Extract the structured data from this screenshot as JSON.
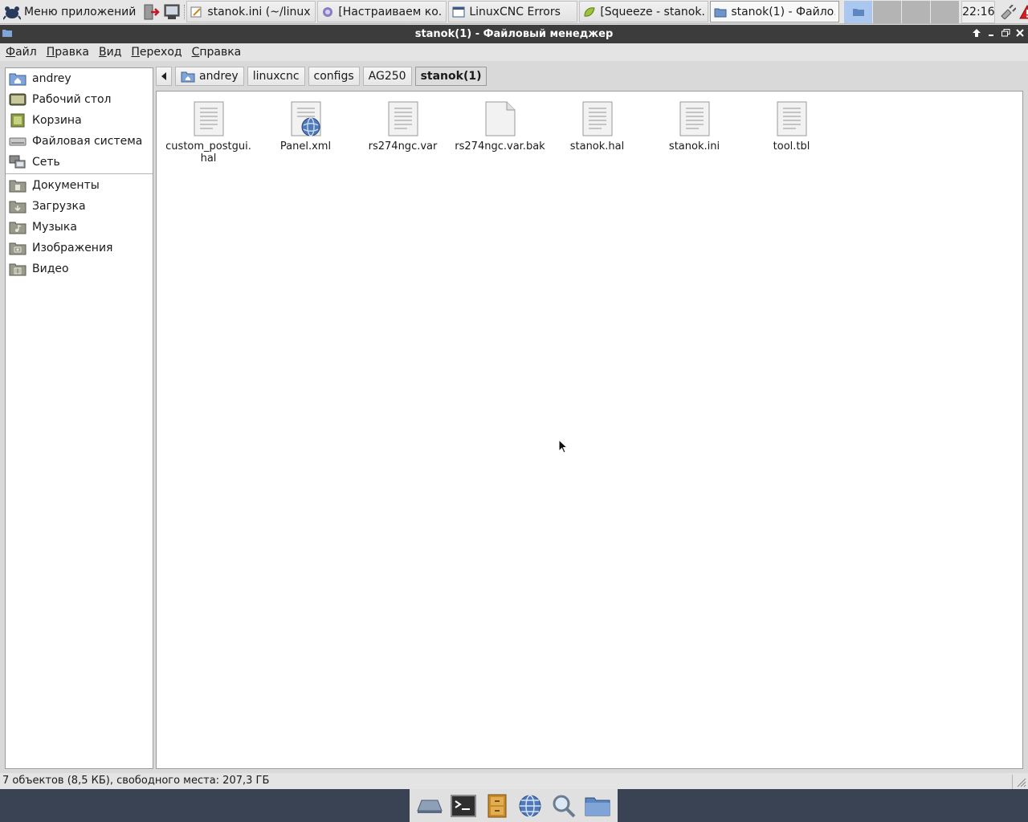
{
  "top_panel": {
    "app_menu_label": "Меню приложений",
    "tasks": [
      {
        "label": "stanok.ini (~/linux...",
        "icon": "edit-icon"
      },
      {
        "label": "[Настраиваем ко...",
        "icon": "browser-icon"
      },
      {
        "label": "LinuxCNC Errors",
        "icon": "window-icon"
      },
      {
        "label": "[Squeeze - stanok...",
        "icon": "leaf-icon"
      },
      {
        "label": "stanok(1) - Файло...",
        "icon": "folder-icon"
      }
    ],
    "clock": "22:16"
  },
  "window": {
    "title": "stanok(1) - Файловый менеджер"
  },
  "menubar": [
    {
      "mnemonic": "Ф",
      "rest": "айл"
    },
    {
      "mnemonic": "П",
      "rest": "равка"
    },
    {
      "mnemonic": "В",
      "rest": "ид"
    },
    {
      "mnemonic": "П",
      "rest": "ереход"
    },
    {
      "mnemonic": "С",
      "rest": "правка"
    }
  ],
  "sidebar": {
    "places": [
      {
        "label": "andrey",
        "icon": "home-folder-icon"
      },
      {
        "label": "Рабочий стол",
        "icon": "desktop-icon"
      },
      {
        "label": "Корзина",
        "icon": "trash-icon"
      },
      {
        "label": "Файловая система",
        "icon": "drive-icon"
      },
      {
        "label": "Сеть",
        "icon": "network-icon"
      }
    ],
    "bookmarks": [
      {
        "label": "Документы",
        "icon": "documents-folder-icon"
      },
      {
        "label": "Загрузка",
        "icon": "downloads-folder-icon"
      },
      {
        "label": "Музыка",
        "icon": "music-folder-icon"
      },
      {
        "label": "Изображения",
        "icon": "pictures-folder-icon"
      },
      {
        "label": "Видео",
        "icon": "video-folder-icon"
      }
    ]
  },
  "pathbar": {
    "crumbs": [
      "andrey",
      "linuxcnc",
      "configs",
      "AG250",
      "stanok(1)"
    ]
  },
  "files": [
    {
      "name": "custom_postgui.hal",
      "icon": "text-file-icon"
    },
    {
      "name": "Panel.xml",
      "icon": "xml-file-icon"
    },
    {
      "name": "rs274ngc.var",
      "icon": "text-file-icon"
    },
    {
      "name": "rs274ngc.var.bak",
      "icon": "blank-file-icon"
    },
    {
      "name": "stanok.hal",
      "icon": "text-file-icon"
    },
    {
      "name": "stanok.ini",
      "icon": "text-file-icon"
    },
    {
      "name": "tool.tbl",
      "icon": "text-file-icon"
    }
  ],
  "statusbar": {
    "text": "7 объектов (8,5 КБ), свободного места: 207,3 ГБ"
  },
  "colors": {
    "titlebar": "#3c3c3c",
    "bottom_panel": "#3a4353",
    "active_workspace": "#a9c7ef"
  }
}
